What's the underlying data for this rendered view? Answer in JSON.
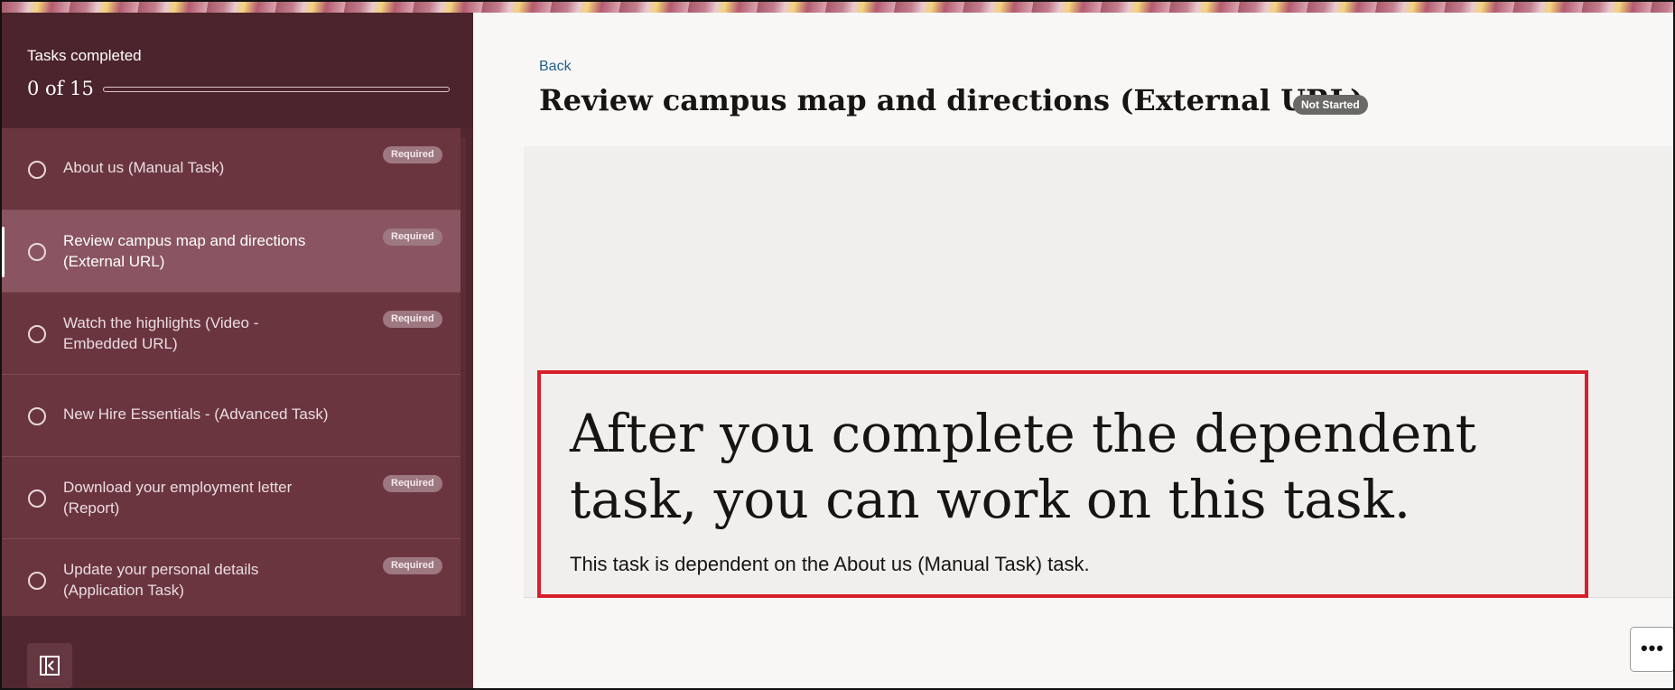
{
  "sidebar": {
    "header": {
      "title": "Tasks completed",
      "count_text": "0 of 15",
      "progress": 0
    },
    "tasks": [
      {
        "label": "About us (Manual Task)",
        "badge": "Required"
      },
      {
        "label": "Review campus map and directions (External URL)",
        "badge": "Required"
      },
      {
        "label": "Watch the highlights (Video - Embedded URL)",
        "badge": "Required"
      },
      {
        "label": "New Hire Essentials - (Advanced Task)",
        "badge": ""
      },
      {
        "label": "Download your employment letter (Report)",
        "badge": "Required"
      },
      {
        "label": "Update your personal details (Application Task)",
        "badge": "Required"
      }
    ],
    "collapse_icon": "panel-collapse-icon"
  },
  "main": {
    "back_label": "Back",
    "title": "Review campus map and directions (External URL)",
    "status": "Not Started",
    "dependency": {
      "headline": "After you complete the dependent task, you can work on this task.",
      "text": "This task is dependent on the About us (Manual Task) task."
    },
    "more_icon": "more-options-icon",
    "more_label": "•••"
  },
  "colors": {
    "sidebar": "#51272f",
    "task_list": "#6b3540",
    "active_task": "#8a5560",
    "highlight": "#d81e2b",
    "link": "#1f5f8e"
  }
}
